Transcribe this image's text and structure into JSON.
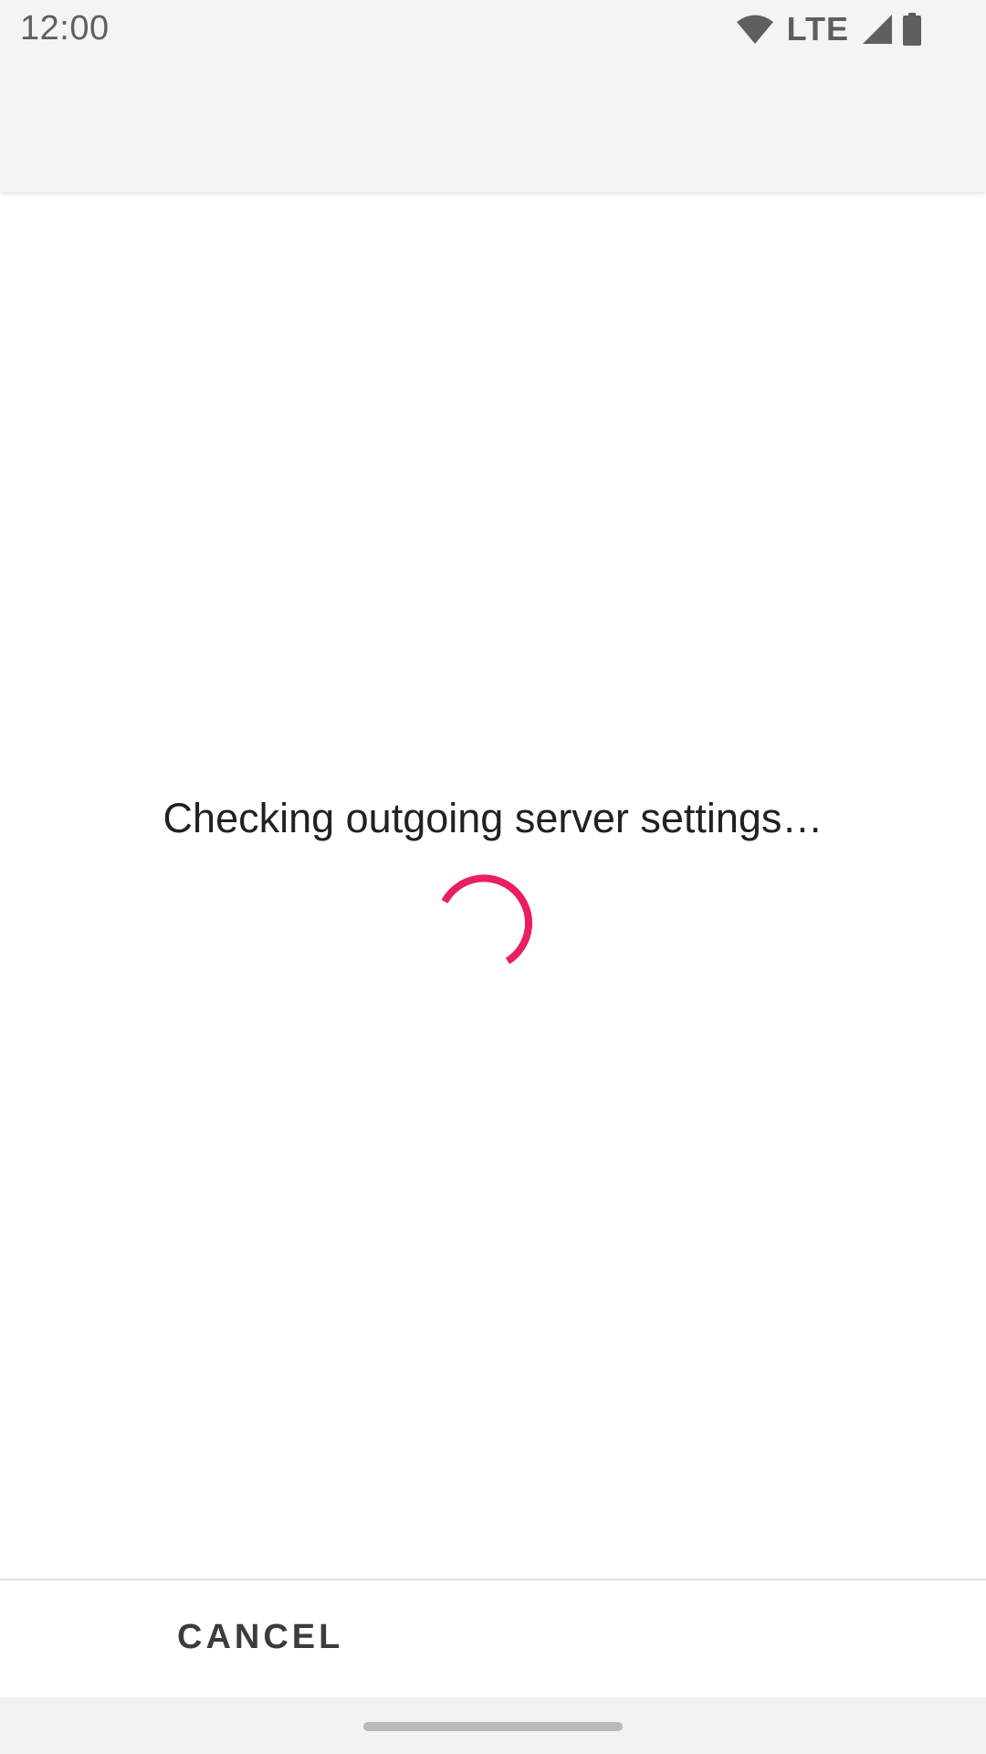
{
  "status_bar": {
    "time": "12:00",
    "network": "LTE",
    "icons": [
      "wifi-icon",
      "signal-icon",
      "battery-icon"
    ]
  },
  "dialog": {
    "message": "Checking outgoing server settings…",
    "spinner_color": "#e91e63"
  },
  "bottom_bar": {
    "cancel_label": "CANCEL"
  },
  "colors": {
    "accent": "#e91e63",
    "status_bar_bg": "#f4f4f4",
    "text_primary": "#212121"
  }
}
